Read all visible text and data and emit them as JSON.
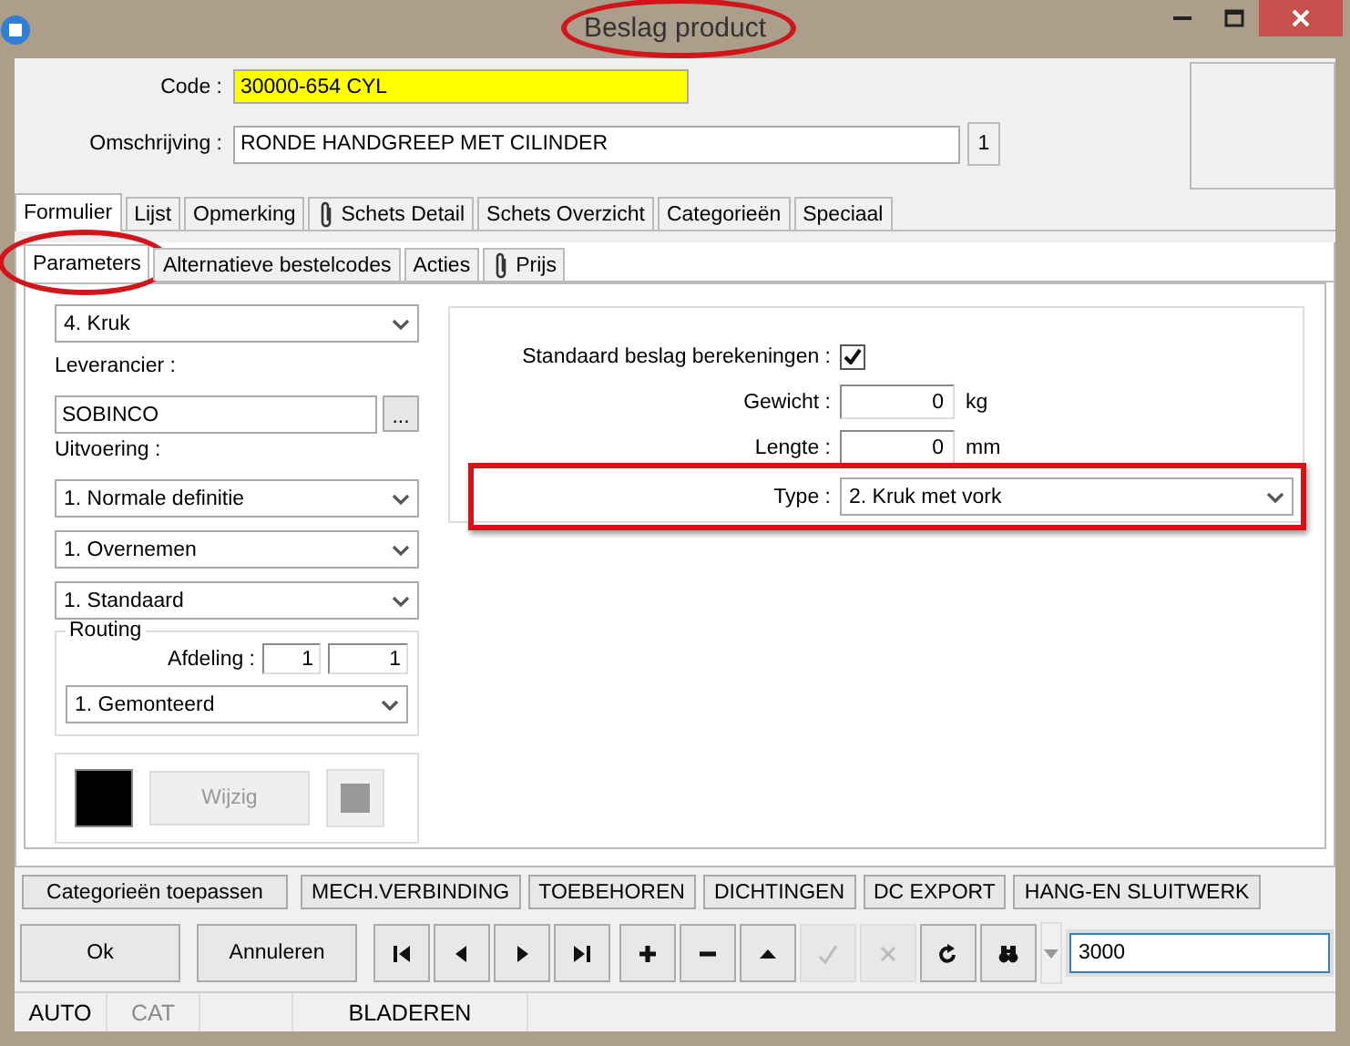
{
  "window": {
    "title": "Beslag product",
    "title_highlighted": true
  },
  "header": {
    "code_label": "Code :",
    "code": "30000-654 CYL",
    "description_label": "Omschrijving :",
    "description": "RONDE HANDGREEP MET CILINDER",
    "counter": "1"
  },
  "tabs": [
    {
      "label": "Formulier",
      "selected": true,
      "attachment": false
    },
    {
      "label": "Lijst",
      "selected": false,
      "attachment": false
    },
    {
      "label": "Opmerking",
      "selected": false,
      "attachment": false
    },
    {
      "label": "Schets Detail",
      "selected": false,
      "attachment": true
    },
    {
      "label": "Schets Overzicht",
      "selected": false,
      "attachment": false
    },
    {
      "label": "Categorieën",
      "selected": false,
      "attachment": false
    },
    {
      "label": "Speciaal",
      "selected": false,
      "attachment": false
    }
  ],
  "subtabs": [
    {
      "label": "Parameters",
      "selected": true,
      "attachment": false,
      "highlighted": true
    },
    {
      "label": "Alternatieve bestelcodes",
      "selected": false,
      "attachment": false,
      "highlighted": false
    },
    {
      "label": "Acties",
      "selected": false,
      "attachment": false,
      "highlighted": false
    },
    {
      "label": "Prijs",
      "selected": false,
      "attachment": true,
      "highlighted": false
    }
  ],
  "left": {
    "category": "4.  Kruk",
    "supplier_label": "Leverancier :",
    "supplier": "SOBINCO",
    "browse": "...",
    "execution_label": "Uitvoering :",
    "selects": [
      "1.  Normale definitie",
      "1.  Overnemen",
      "1.  Standaard"
    ],
    "routing": {
      "title": "Routing",
      "department_label": "Afdeling :",
      "department": [
        "1",
        "1"
      ],
      "mode": "1.  Gemonteerd"
    },
    "color_button": {
      "label": "Wijzig",
      "disabled": true
    }
  },
  "right": {
    "standard_label": "Standaard beslag berekeningen :",
    "standard_checked": true,
    "weight_label": "Gewicht :",
    "weight": "0",
    "weight_unit": "kg",
    "length_label": "Lengte :",
    "length": "0",
    "length_unit": "mm",
    "type_label": "Type :",
    "type": "2.  Kruk met vork",
    "type_highlighted": true
  },
  "action_buttons": [
    "Categorieën toepassen",
    "MECH.VERBINDING",
    "TOEBEHOREN",
    "DICHTINGEN",
    "DC EXPORT",
    "HANG-EN SLUITWERK"
  ],
  "dialog_buttons": [
    "Ok",
    "Annuleren"
  ],
  "toolbar": [
    {
      "kind": "first",
      "disabled": false
    },
    {
      "kind": "previous",
      "disabled": false
    },
    {
      "kind": "next",
      "disabled": false
    },
    {
      "kind": "last",
      "disabled": false
    },
    {
      "kind": "add",
      "disabled": false
    },
    {
      "kind": "remove",
      "disabled": false
    },
    {
      "kind": "up",
      "disabled": false
    },
    {
      "kind": "confirm",
      "disabled": true
    },
    {
      "kind": "cancel",
      "disabled": true
    },
    {
      "kind": "refresh",
      "disabled": false
    },
    {
      "kind": "find",
      "disabled": false
    }
  ],
  "search": {
    "value": "3000"
  },
  "status_bar": [
    {
      "text": "AUTO",
      "disabled": false
    },
    {
      "text": "CAT",
      "disabled": true
    },
    {
      "text": "BLADEREN",
      "disabled": false
    }
  ]
}
